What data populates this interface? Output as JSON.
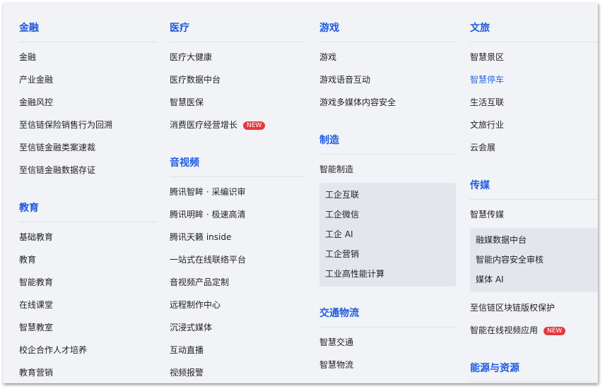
{
  "colors": {
    "heading": "#1f5be0",
    "badge": "#e23a3f",
    "active": "#2d64e8"
  },
  "badge": "NEW",
  "col1": [
    {
      "title": "金融",
      "items": [
        "金融",
        "产业金融",
        "金融风控",
        "至信链保险销售行为回溯",
        "至信链金融类案速裁",
        "至信链金融数据存证"
      ]
    },
    {
      "title": "教育",
      "items": [
        "基础教育",
        "教育",
        "智能教育",
        "在线课堂",
        "智慧教室",
        "校企合作人才培养",
        "教育营销"
      ]
    }
  ],
  "col2": [
    {
      "title": "医疗",
      "items": [
        "医疗大健康",
        "医疗数据中台",
        "智慧医保",
        "消费医疗经营增长"
      ]
    },
    {
      "title": "音视频",
      "items": [
        "腾讯智眸 · 采编识审",
        "腾讯明眸 · 极速高清",
        "腾讯天籁 inside",
        "一站式在线联络平台",
        "音视频产品定制",
        "远程制作中心",
        "沉浸式媒体",
        "互动直播",
        "视频报警"
      ]
    }
  ],
  "col3": [
    {
      "title": "游戏",
      "items": [
        "游戏",
        "游戏语音互动",
        "游戏多媒体内容安全"
      ]
    },
    {
      "title": "制造",
      "items": [
        "智能制造"
      ],
      "sub": [
        "工企互联",
        "工企微信",
        "工企 AI",
        "工企营销",
        "工业高性能计算"
      ]
    },
    {
      "title": "交通物流",
      "items": [
        "智慧交通",
        "智慧物流"
      ]
    }
  ],
  "col4": [
    {
      "title": "文旅",
      "items": [
        "智慧景区",
        "智慧停车",
        "生活互联",
        "文旅行业",
        "云会展"
      ]
    },
    {
      "title": "传媒",
      "items": [
        "智慧传媒"
      ],
      "sub": [
        "融媒数据中台",
        "智能内容安全审核",
        "媒体 AI"
      ],
      "after": [
        "至信链区块链版权保护",
        "智能在线视频应用"
      ]
    },
    {
      "title": "能源与资源",
      "items": []
    }
  ]
}
